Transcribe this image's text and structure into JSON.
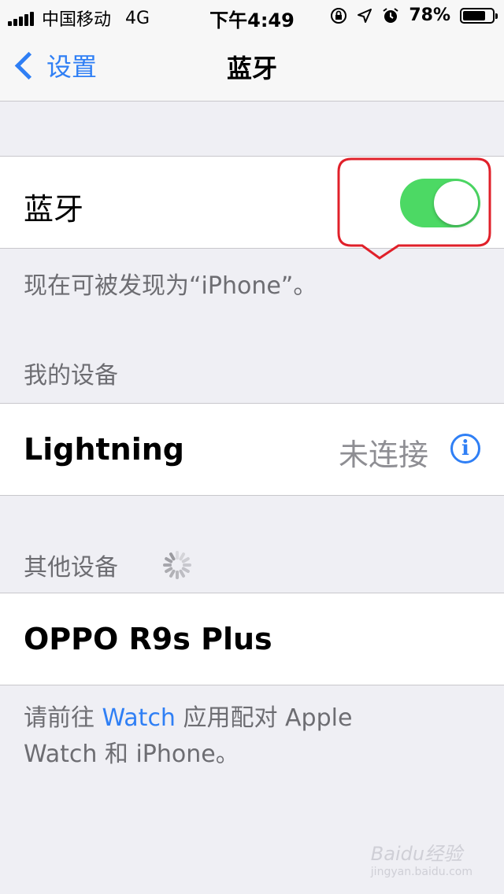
{
  "status_bar": {
    "carrier": "中国移动",
    "network": "4G",
    "time": "下午4:49",
    "battery_percent": "78%",
    "battery_level": 0.78
  },
  "nav": {
    "back_label": "设置",
    "title": "蓝牙"
  },
  "bluetooth": {
    "label": "蓝牙",
    "enabled": true,
    "discoverable_text": "现在可被发现为“iPhone”。"
  },
  "my_devices": {
    "header": "我的设备",
    "items": [
      {
        "name": "Lightning",
        "status": "未连接"
      }
    ]
  },
  "other_devices": {
    "header": "其他设备",
    "items": [
      {
        "name": "OPPO R9s Plus"
      }
    ]
  },
  "footer": {
    "prefix": "请前往 ",
    "link": "Watch",
    "suffix": " 应用配对 Apple",
    "line2": "Watch 和 iPhone。"
  },
  "watermark": {
    "brand": "Baidu经验",
    "url": "jingyan.baidu.com"
  },
  "colors": {
    "accent": "#2f7ff5",
    "toggle_on": "#4cd964",
    "annotation": "#e0202a"
  }
}
